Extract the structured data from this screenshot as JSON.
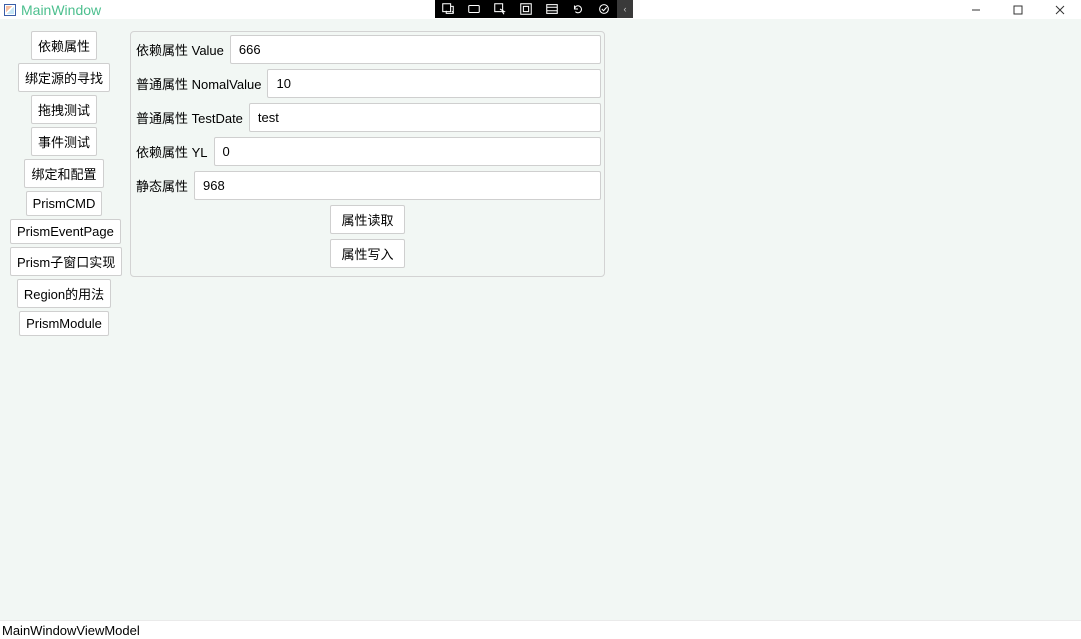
{
  "titlebar": {
    "title": "MainWindow"
  },
  "toolbar": {
    "icons": [
      "toggle-live-tree",
      "select-box",
      "select-cursor",
      "focus-rect",
      "layout-bounds",
      "refresh",
      "check"
    ],
    "chevron": "‹"
  },
  "window_controls": {
    "minimize": "—",
    "maximize": "▢",
    "close": "✕"
  },
  "sidebar": {
    "items": [
      {
        "label": "依赖属性"
      },
      {
        "label": "绑定源的寻找"
      },
      {
        "label": "拖拽测试"
      },
      {
        "label": "事件测试"
      },
      {
        "label": "绑定和配置"
      },
      {
        "label": "PrismCMD"
      },
      {
        "label": "PrismEventPage"
      },
      {
        "label": "Prism子窗口实现"
      },
      {
        "label": "Region的用法"
      },
      {
        "label": "PrismModule"
      }
    ]
  },
  "panel": {
    "rows": [
      {
        "label": "依赖属性 Value",
        "value": "666"
      },
      {
        "label": "普通属性 NomalValue",
        "value": "10"
      },
      {
        "label": "普通属性 TestDate",
        "value": "test"
      },
      {
        "label": "依赖属性 YL",
        "value": "0"
      },
      {
        "label": "静态属性",
        "value": "968"
      }
    ],
    "buttons": {
      "read": "属性读取",
      "write": "属性写入"
    }
  },
  "status": {
    "text": "MainWindowViewModel"
  }
}
